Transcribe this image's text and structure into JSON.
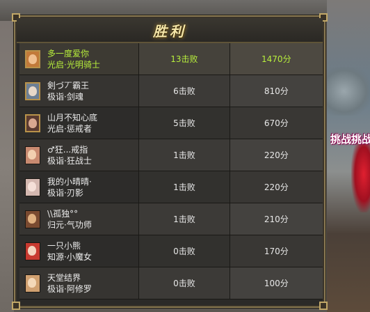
{
  "title": "胜利",
  "challenge_banner": "挑战挑战",
  "players": [
    {
      "name": "多一度爱你",
      "class": "光启·光明骑士",
      "defeats": "13击败",
      "score": "1470分",
      "winner": true,
      "avatar_colors": {
        "bg": "#c27a3a",
        "face": "#f0c090"
      }
    },
    {
      "name": "剣づ丆霸王",
      "class": "极诣·剑魂",
      "defeats": "6击败",
      "score": "810分",
      "winner": false,
      "avatar_colors": {
        "bg": "#6d7f94",
        "face": "#e8d8c8"
      }
    },
    {
      "name": "山月不知心底",
      "class": "光启·惩戒者",
      "defeats": "5击败",
      "score": "670分",
      "winner": false,
      "avatar_colors": {
        "bg": "#5a3a30",
        "face": "#d8a890"
      }
    },
    {
      "name": "♂狂...戒指",
      "class": "极诣·狂战士",
      "defeats": "1击败",
      "score": "220分",
      "winner": false,
      "avatar_colors": {
        "bg": "#c88a70",
        "face": "#f2d0b0"
      }
    },
    {
      "name": "我的小晴晴·",
      "class": "极诣·刃影",
      "defeats": "1击败",
      "score": "220分",
      "winner": false,
      "avatar_colors": {
        "bg": "#d4b8b0",
        "face": "#f5e0d8"
      }
    },
    {
      "name": "\\\\孤独°°",
      "class": "归元·气功师",
      "defeats": "1击败",
      "score": "210分",
      "winner": false,
      "avatar_colors": {
        "bg": "#7a4a30",
        "face": "#e0b080"
      }
    },
    {
      "name": "一只小熊",
      "class": "知源·小魔女",
      "defeats": "0击败",
      "score": "170分",
      "winner": false,
      "avatar_colors": {
        "bg": "#c83a30",
        "face": "#f4d4c0"
      }
    },
    {
      "name": "天堂结界",
      "class": "极诣·阿修罗",
      "defeats": "0击败",
      "score": "100分",
      "winner": false,
      "avatar_colors": {
        "bg": "#d0a070",
        "face": "#f4d8b8"
      }
    }
  ]
}
